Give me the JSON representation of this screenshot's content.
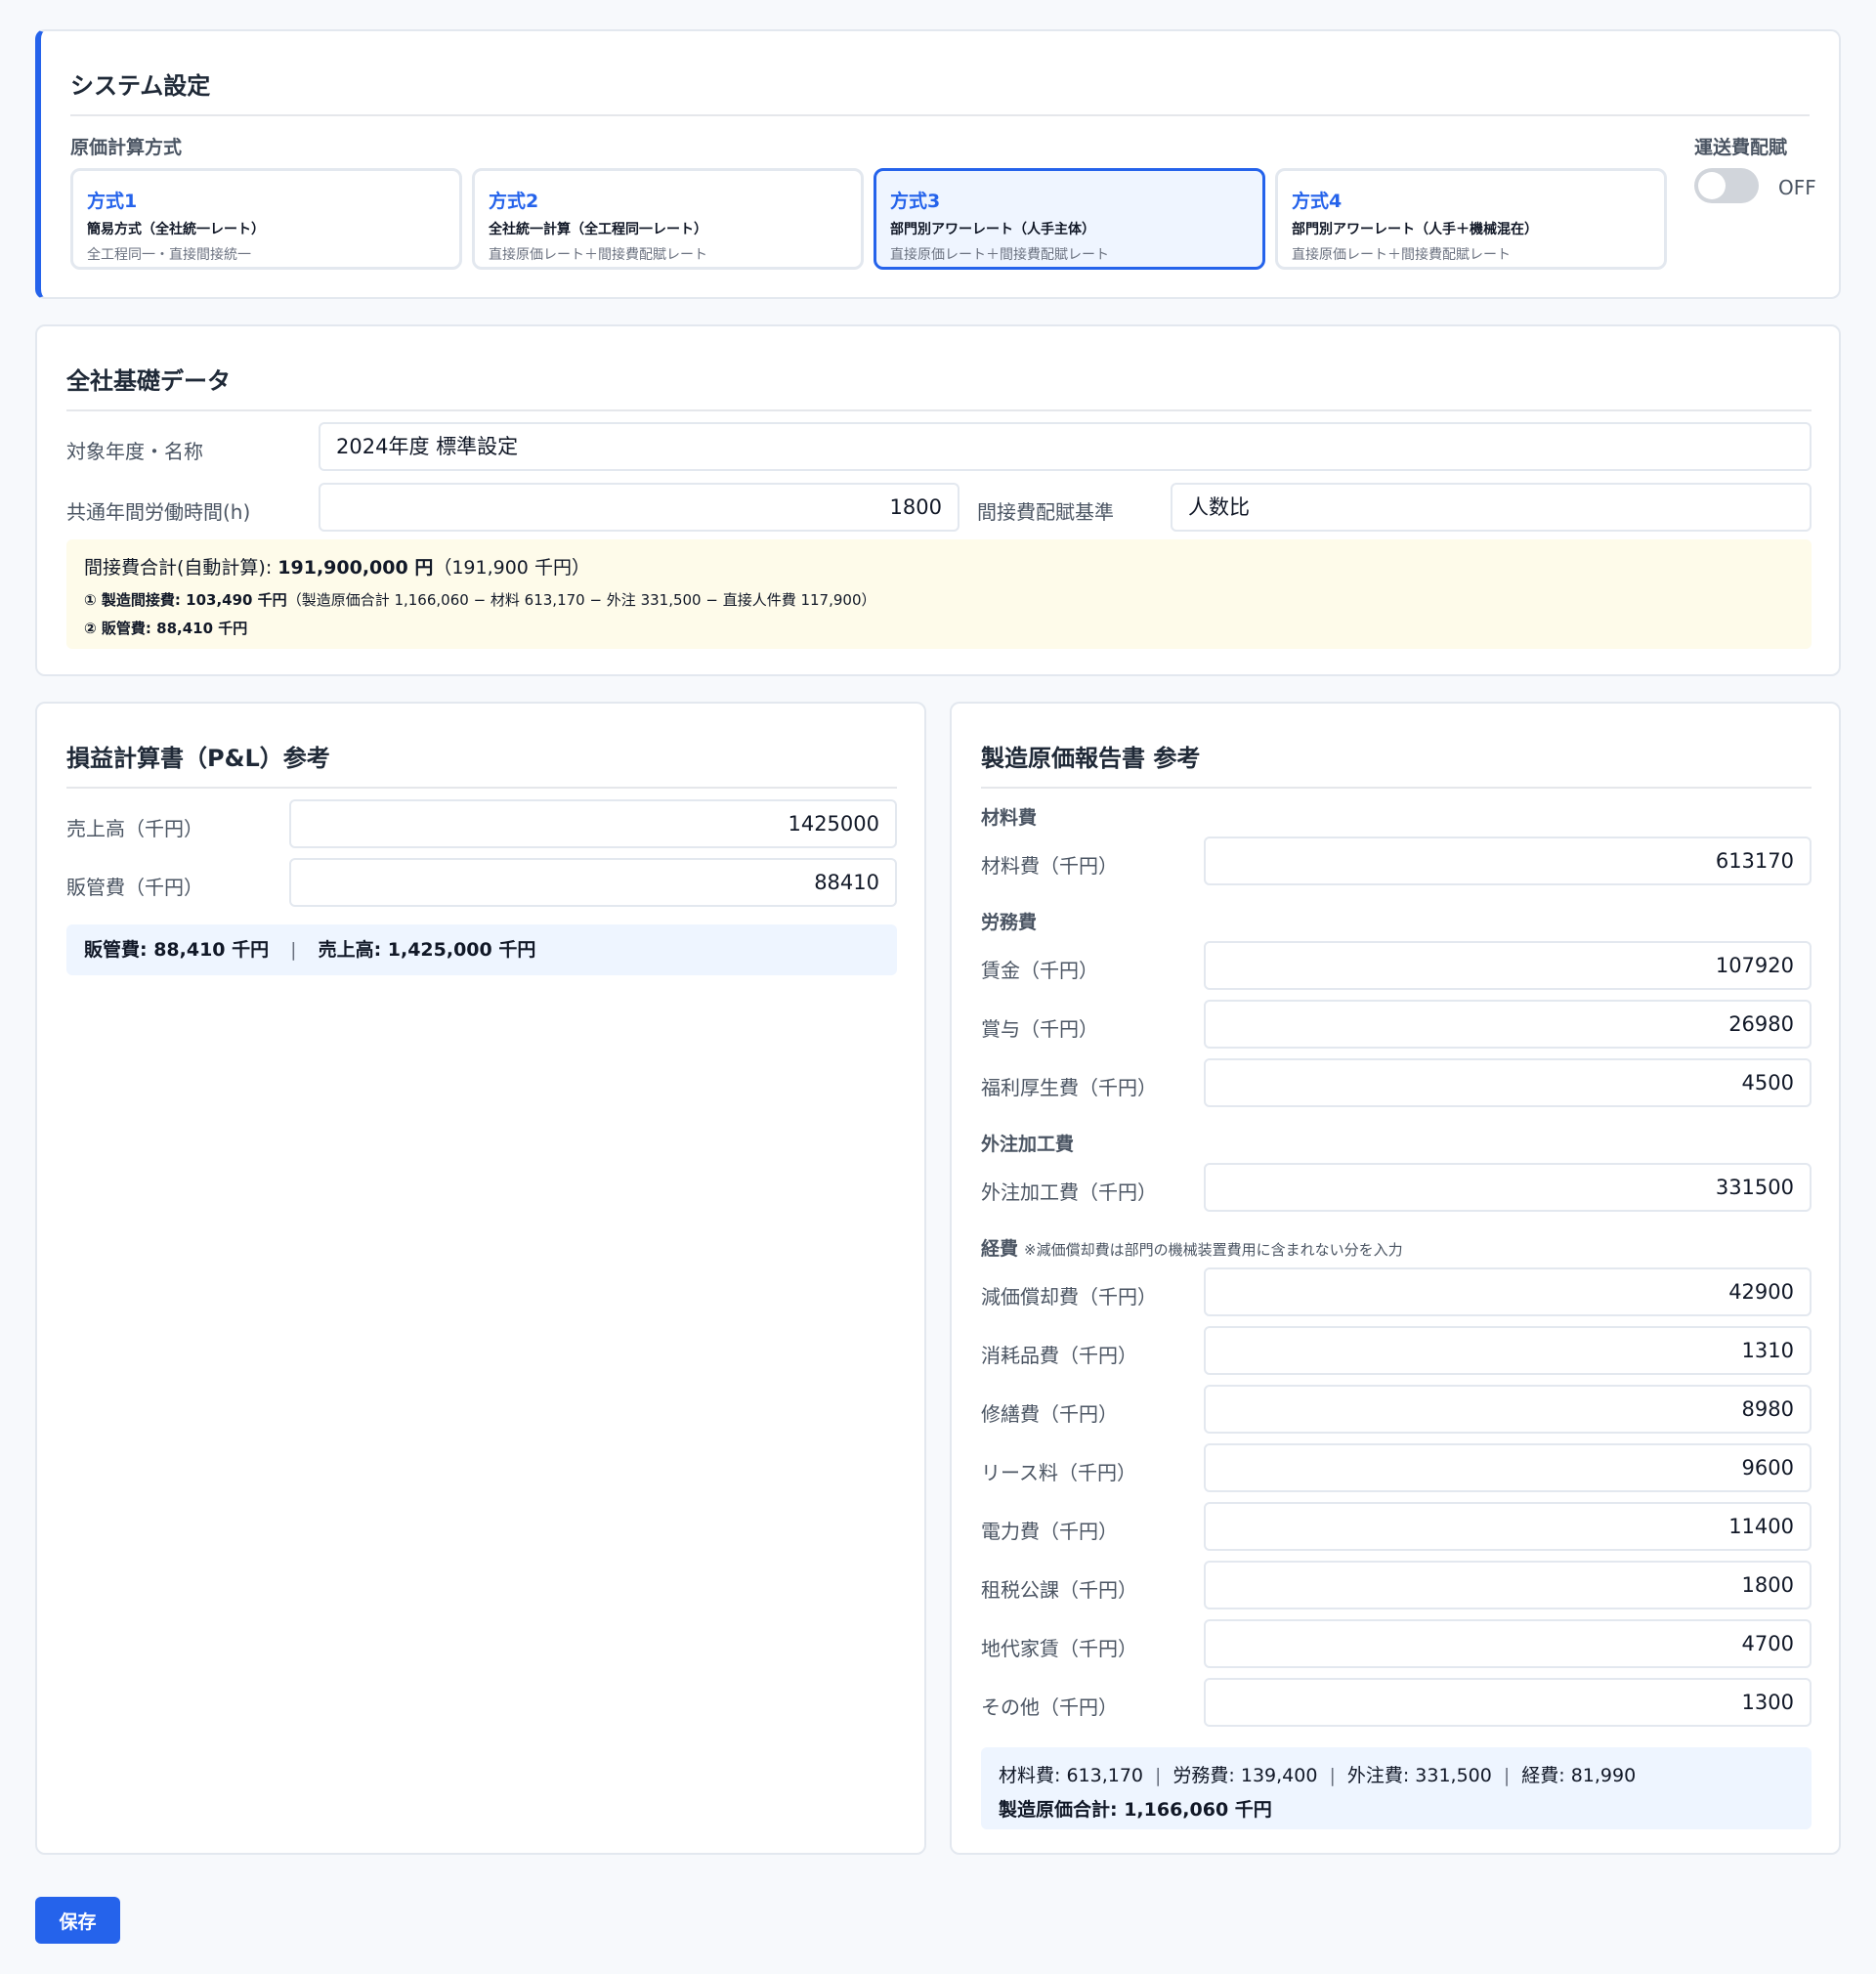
{
  "system": {
    "title": "システム設定",
    "method_label": "原価計算方式",
    "methods": [
      {
        "name": "方式1",
        "desc": "簡易方式（全社統一レート）",
        "sub": "全工程同一・直接間接統一"
      },
      {
        "name": "方式2",
        "desc": "全社統一計算（全工程同一レート）",
        "sub": "直接原価レート＋間接費配賦レート"
      },
      {
        "name": "方式3",
        "desc": "部門別アワーレート（人手主体）",
        "sub": "直接原価レート＋間接費配賦レート"
      },
      {
        "name": "方式4",
        "desc": "部門別アワーレート（人手＋機械混在）",
        "sub": "直接原価レート＋間接費配賦レート"
      }
    ],
    "selected_method": "方式3",
    "shipping_label": "運送費配賦",
    "shipping_state": "OFF",
    "accent_color": "#2563eb"
  },
  "base": {
    "title": "全社基礎データ",
    "year_label": "対象年度・名称",
    "year_value": "2024年度 標準設定",
    "hours_label": "共通年間労働時間(h)",
    "hours_value": "1800",
    "basis_label": "間接費配賦基準",
    "basis_value": "人数比",
    "note_prefix": "間接費合計(自動計算): ",
    "note_total": "191,900,000 円",
    "note_total_k": "（191,900 千円）",
    "note_line1_bold": "① 製造間接費: 103,490 千円",
    "note_line1_rest": "（製造原価合計 1,166,060 − 材料 613,170 − 外注 331,500 − 直接人件費 117,900）",
    "note_line2_bold": "② 販管費: 88,410 千円"
  },
  "pl": {
    "title": "損益計算書（P&L）参考",
    "sales_label": "売上高（千円）",
    "sales_value": "1425000",
    "sga_label": "販管費（千円）",
    "sga_value": "88410",
    "summary_sga": "販管費: 88,410 千円",
    "summary_sep": "|",
    "summary_sales": "売上高: 1,425,000 千円"
  },
  "mfg": {
    "title": "製造原価報告書 参考",
    "material_head": "材料費",
    "material_label": "材料費（千円）",
    "material_value": "613170",
    "labor_head": "労務費",
    "wage_label": "賃金（千円）",
    "wage_value": "107920",
    "bonus_label": "賞与（千円）",
    "bonus_value": "26980",
    "welfare_label": "福利厚生費（千円）",
    "welfare_value": "4500",
    "outsource_head": "外注加工費",
    "outsource_label": "外注加工費（千円）",
    "outsource_value": "331500",
    "expense_head": "経費",
    "expense_note": "※減価償却費は部門の機械装置費用に含まれない分を入力",
    "expenses": [
      {
        "label": "減価償却費（千円）",
        "value": "42900"
      },
      {
        "label": "消耗品費（千円）",
        "value": "1310"
      },
      {
        "label": "修繕費（千円）",
        "value": "8980"
      },
      {
        "label": "リース料（千円）",
        "value": "9600"
      },
      {
        "label": "電力費（千円）",
        "value": "11400"
      },
      {
        "label": "租税公課（千円）",
        "value": "1800"
      },
      {
        "label": "地代家賃（千円）",
        "value": "4700"
      },
      {
        "label": "その他（千円）",
        "value": "1300"
      }
    ],
    "summary_material": "材料費: 613,170",
    "summary_labor": "労務費: 139,400",
    "summary_outsource": "外注費: 331,500",
    "summary_expense": "経費: 81,990",
    "summary_sep": "|",
    "summary_total": "製造原価合計: 1,166,060 千円"
  },
  "actions": {
    "save_label": "保存"
  }
}
